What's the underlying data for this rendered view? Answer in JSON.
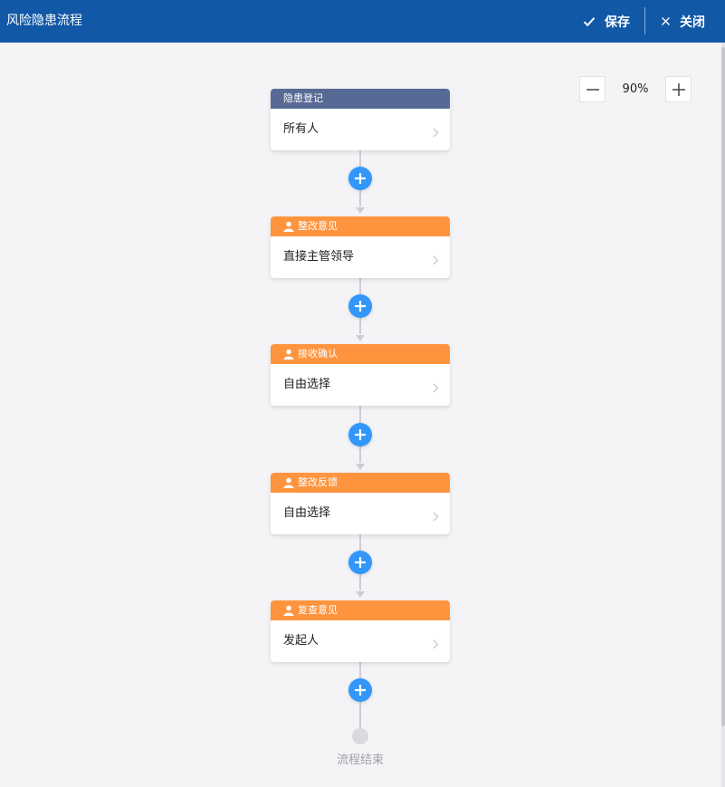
{
  "header": {
    "title": "风险隐患流程",
    "save_label": "保存",
    "close_label": "关闭"
  },
  "zoom": {
    "value": "90%"
  },
  "nodes": [
    {
      "type": "start",
      "title": "隐患登记",
      "content": "所有人"
    },
    {
      "type": "approver",
      "title": "整改意见",
      "content": "直接主管领导"
    },
    {
      "type": "approver",
      "title": "接收确认",
      "content": "自由选择"
    },
    {
      "type": "approver",
      "title": "整改反馈",
      "content": "自由选择"
    },
    {
      "type": "approver",
      "title": "复查意见",
      "content": "发起人"
    }
  ],
  "end": {
    "label": "流程结束"
  },
  "colors": {
    "topbar": "#1158a7",
    "start_header": "#576a95",
    "approver_header": "#ff943e",
    "add_button": "#3296fa",
    "canvas": "#f4f4f6"
  },
  "icons": {
    "save": "check-icon",
    "close": "close-icon",
    "zoom_out": "minus-icon",
    "zoom_in": "plus-icon",
    "add": "plus-icon",
    "node_user": "user-icon",
    "node_open": "chevron-right-icon"
  }
}
